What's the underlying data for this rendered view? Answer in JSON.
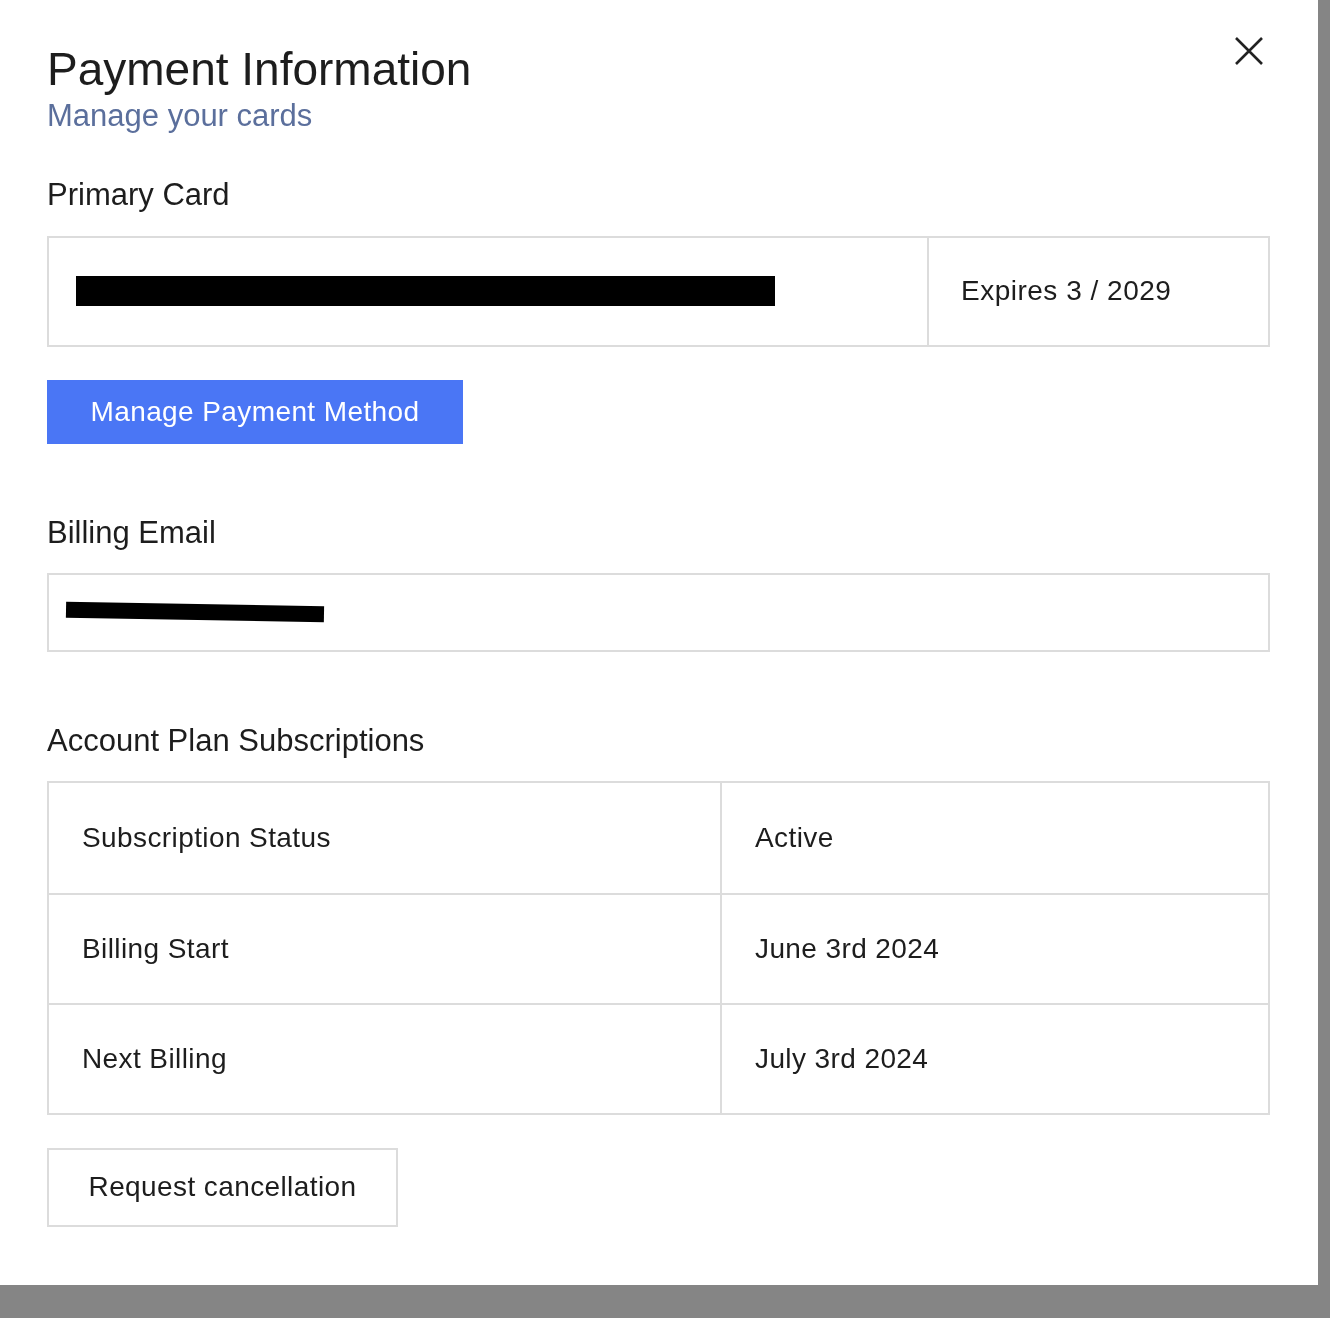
{
  "dialog": {
    "title": "Payment Information",
    "subtitle": "Manage your cards"
  },
  "primary_card": {
    "heading": "Primary Card",
    "expiry": "Expires 3 / 2029"
  },
  "manage_button": "Manage Payment Method",
  "billing_email": {
    "heading": "Billing Email"
  },
  "subscriptions": {
    "heading": "Account Plan Subscriptions",
    "rows": [
      {
        "label": "Subscription Status",
        "value": "Active"
      },
      {
        "label": "Billing Start",
        "value": "June 3rd 2024"
      },
      {
        "label": "Next Billing",
        "value": "July 3rd 2024"
      }
    ]
  },
  "cancel_button": "Request cancellation"
}
